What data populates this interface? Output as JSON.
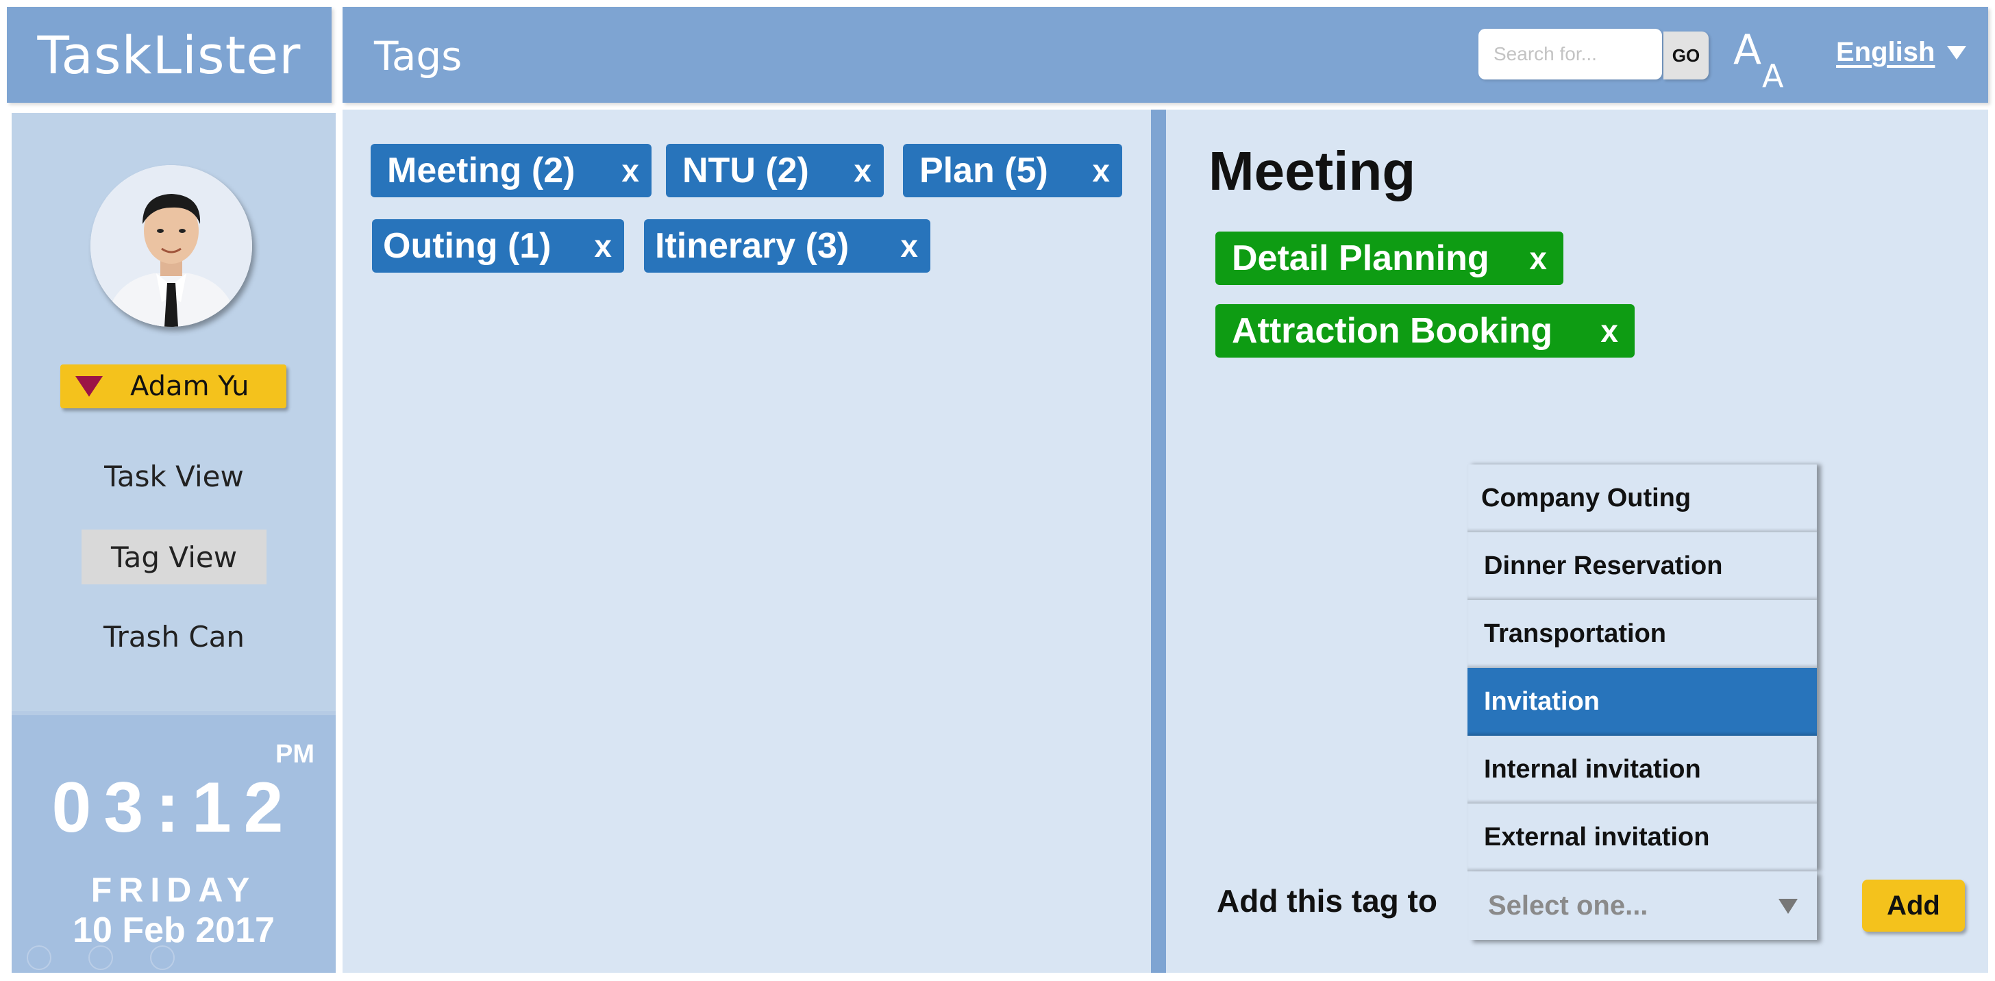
{
  "app": {
    "name": "TaskLister"
  },
  "header": {
    "title": "Tags",
    "search_placeholder": "Search for...",
    "go_label": "GO",
    "font_size_big": "A",
    "font_size_small": "A",
    "language": "English"
  },
  "sidebar": {
    "user_name": "Adam Yu",
    "nav": [
      {
        "label": "Task View",
        "active": false
      },
      {
        "label": "Tag View",
        "active": true
      },
      {
        "label": "Trash Can",
        "active": false
      }
    ],
    "clock": {
      "meridiem": "PM",
      "time": "03:12",
      "day": "FRIDAY",
      "date": "10 Feb 2017"
    }
  },
  "tags": [
    {
      "label": "Meeting (2)",
      "remove": "x"
    },
    {
      "label": "NTU (2)",
      "remove": "x"
    },
    {
      "label": "Plan (5)",
      "remove": "x"
    },
    {
      "label": "Outing (1)",
      "remove": "x"
    },
    {
      "label": "Itinerary (3)",
      "remove": "x"
    }
  ],
  "detail": {
    "title": "Meeting",
    "subtags": [
      {
        "label": "Detail Planning",
        "remove": "x"
      },
      {
        "label": "Attraction Booking",
        "remove": "x"
      }
    ],
    "options": [
      "Company Outing",
      "Dinner Reservation",
      "Transportation",
      "Invitation",
      "Internal invitation",
      "External invitation"
    ],
    "selected_option": "Invitation",
    "add_label": "Add this tag to",
    "select_placeholder": "Select one...",
    "add_button": "Add"
  },
  "colors": {
    "header_bg": "#7ea4d2",
    "sidebar_bg": "#bed2e8",
    "panel_bg": "#d9e5f3",
    "tag_blue": "#2874bb",
    "subtag_green": "#0e9c13",
    "accent_yellow": "#f4c21c",
    "user_triangle": "#9b1346"
  }
}
